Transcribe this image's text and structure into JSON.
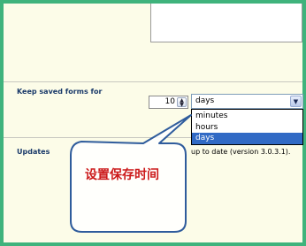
{
  "keep_forms": {
    "label": "Keep saved forms for",
    "spinner_value": "10",
    "select": {
      "value": "days",
      "options": [
        "minutes",
        "hours",
        "days"
      ],
      "selected_index": 2
    }
  },
  "updates": {
    "label": "Updates",
    "text": "up to date (version 3.0.3.1)."
  },
  "callout": {
    "text": "设置保存时间"
  },
  "colors": {
    "frame": "#3fb37c",
    "background": "#fcfce8",
    "selection": "#316ac5",
    "callout_text": "#cc1a1a"
  },
  "icons": {
    "spinner": "spinner-updown-icon",
    "select": "chevron-down-icon"
  }
}
